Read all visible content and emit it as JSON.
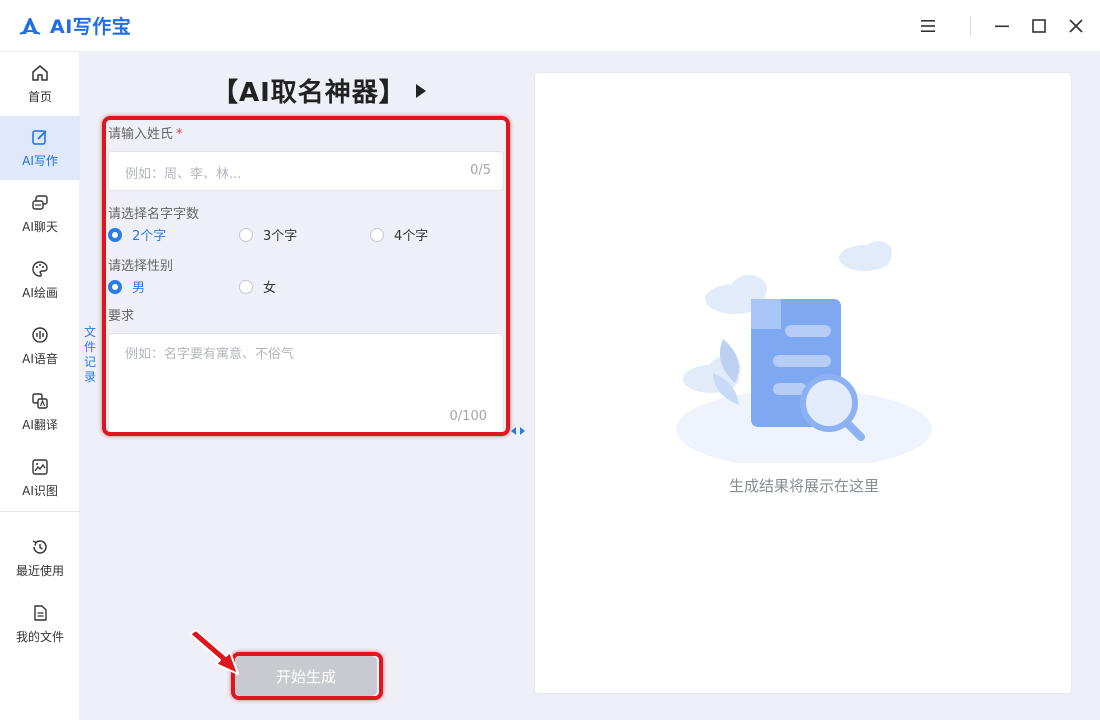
{
  "app": {
    "title": "AI写作宝",
    "brand_color": "#1f6ee5"
  },
  "window_controls": {
    "menu_icon": "hamburger-icon",
    "minimize_icon": "minimize-icon",
    "maximize_icon": "maximize-icon",
    "close_icon": "close-icon"
  },
  "sidebar": {
    "items": [
      {
        "label": "首页",
        "icon": "home-icon",
        "active": false
      },
      {
        "label": "AI写作",
        "icon": "edit-icon",
        "active": true
      },
      {
        "label": "AI聊天",
        "icon": "chat-icon",
        "active": false
      },
      {
        "label": "AI绘画",
        "icon": "palette-icon",
        "active": false
      },
      {
        "label": "AI语音",
        "icon": "voice-icon",
        "active": false
      },
      {
        "label": "AI翻译",
        "icon": "translate-icon",
        "active": false
      },
      {
        "label": "AI识图",
        "icon": "image-icon",
        "active": false
      },
      {
        "label": "最近使用",
        "icon": "history-icon",
        "active": false
      },
      {
        "label": "我的文件",
        "icon": "file-icon",
        "active": false
      }
    ]
  },
  "form": {
    "title": "【AI取名神器】",
    "surname": {
      "label": "请输入姓氏",
      "required_mark": "*",
      "placeholder": "例如：周、李、林...",
      "counter": "0/5"
    },
    "name_length": {
      "label": "请选择名字字数",
      "options": [
        "2个字",
        "3个字",
        "4个字"
      ],
      "selected": "2个字"
    },
    "gender": {
      "label": "请选择性别",
      "options": [
        "男",
        "女"
      ],
      "selected": "男"
    },
    "requirements": {
      "label": "要求",
      "placeholder": "例如：名字要有寓意、不俗气",
      "counter": "0/100"
    },
    "start_button": "开始生成"
  },
  "side_tab": {
    "chars": [
      "文",
      "件",
      "记",
      "录"
    ]
  },
  "result": {
    "placeholder_text": "生成结果将展示在这里",
    "illustration": "document-search-illustration"
  },
  "colors": {
    "accent": "#2b7be9",
    "annotation_red": "#e0161e",
    "disabled_button": "#c9cacf"
  }
}
